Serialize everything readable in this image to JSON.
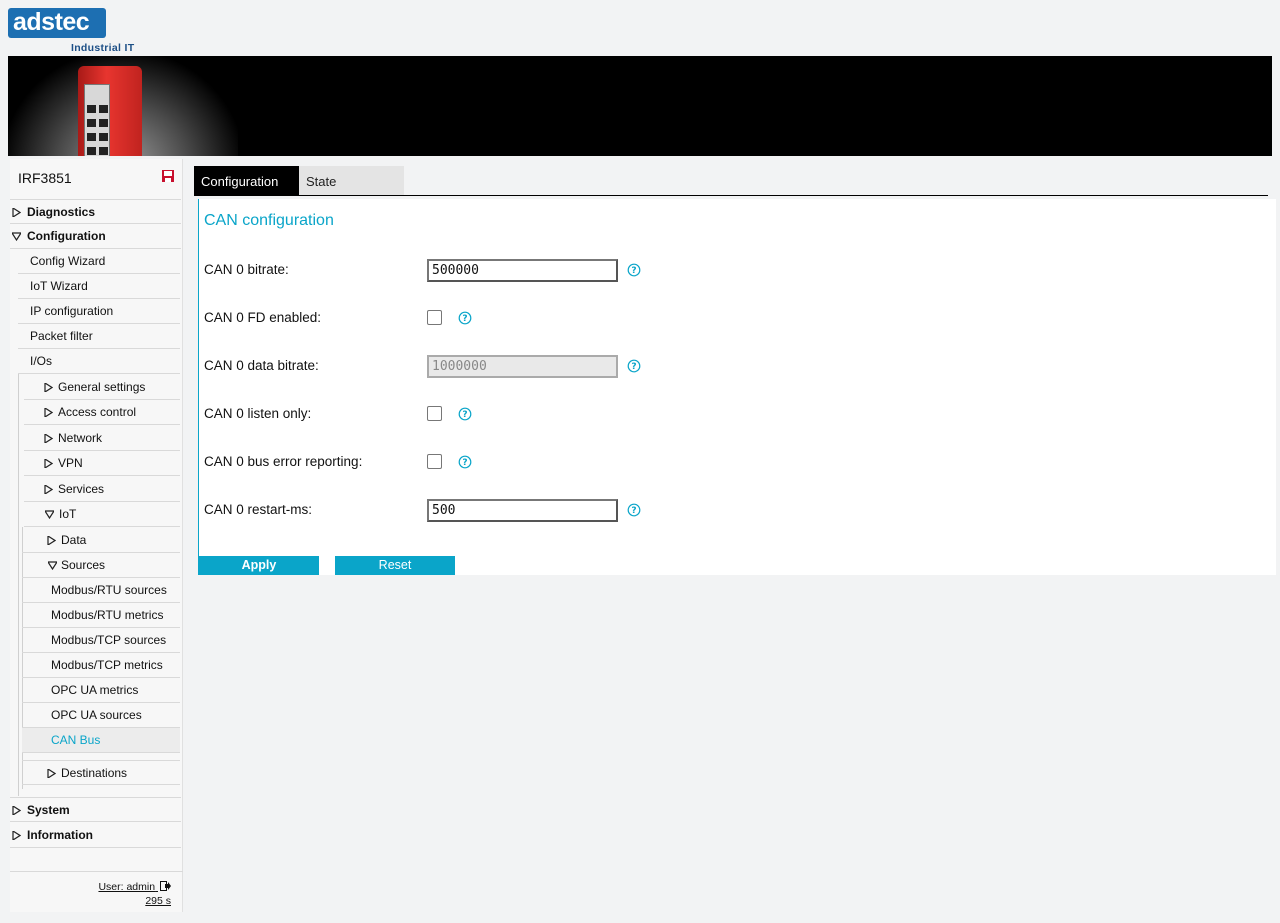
{
  "brand": {
    "logo_text": "adstec",
    "tagline": "Industrial IT"
  },
  "sidebar": {
    "device_name": "IRF3851",
    "top_items": {
      "diagnostics": "Diagnostics",
      "configuration": "Configuration",
      "system": "System",
      "information": "Information"
    },
    "config_items": [
      "Config Wizard",
      "IoT Wizard",
      "IP configuration",
      "Packet filter",
      "I/Os"
    ],
    "sub_items": [
      "General settings",
      "Access control",
      "Network",
      "VPN",
      "Services",
      "IoT"
    ],
    "iot_items": {
      "data": "Data",
      "sources": "Sources",
      "destinations": "Destinations"
    },
    "source_items": [
      "Modbus/RTU sources",
      "Modbus/RTU metrics",
      "Modbus/TCP sources",
      "Modbus/TCP metrics",
      "OPC UA metrics",
      "OPC UA sources",
      "CAN Bus"
    ],
    "active_item": "CAN Bus",
    "user_label": "User: admin",
    "session_timer": "295 s"
  },
  "tabs": {
    "configuration": "Configuration",
    "state": "State"
  },
  "panel": {
    "title": "CAN configuration",
    "fields": {
      "bitrate_label": "CAN 0 bitrate:",
      "bitrate_value": "500000",
      "fd_label": "CAN 0 FD enabled:",
      "fd_checked": false,
      "data_bitrate_label": "CAN 0 data bitrate:",
      "data_bitrate_value": "1000000",
      "listen_label": "CAN 0 listen only:",
      "listen_checked": false,
      "bus_error_label": "CAN 0 bus error reporting:",
      "bus_error_checked": false,
      "restart_label": "CAN 0 restart-ms:",
      "restart_value": "500"
    },
    "apply_label": "Apply",
    "reset_label": "Reset"
  },
  "colors": {
    "accent": "#0aa5c9",
    "brand_blue": "#1d6fb2",
    "banner": "#000000",
    "save_icon": "#c8102e"
  },
  "icons": [
    "save-icon",
    "help-icon",
    "triangle-right-icon",
    "triangle-down-icon",
    "logout-icon"
  ]
}
